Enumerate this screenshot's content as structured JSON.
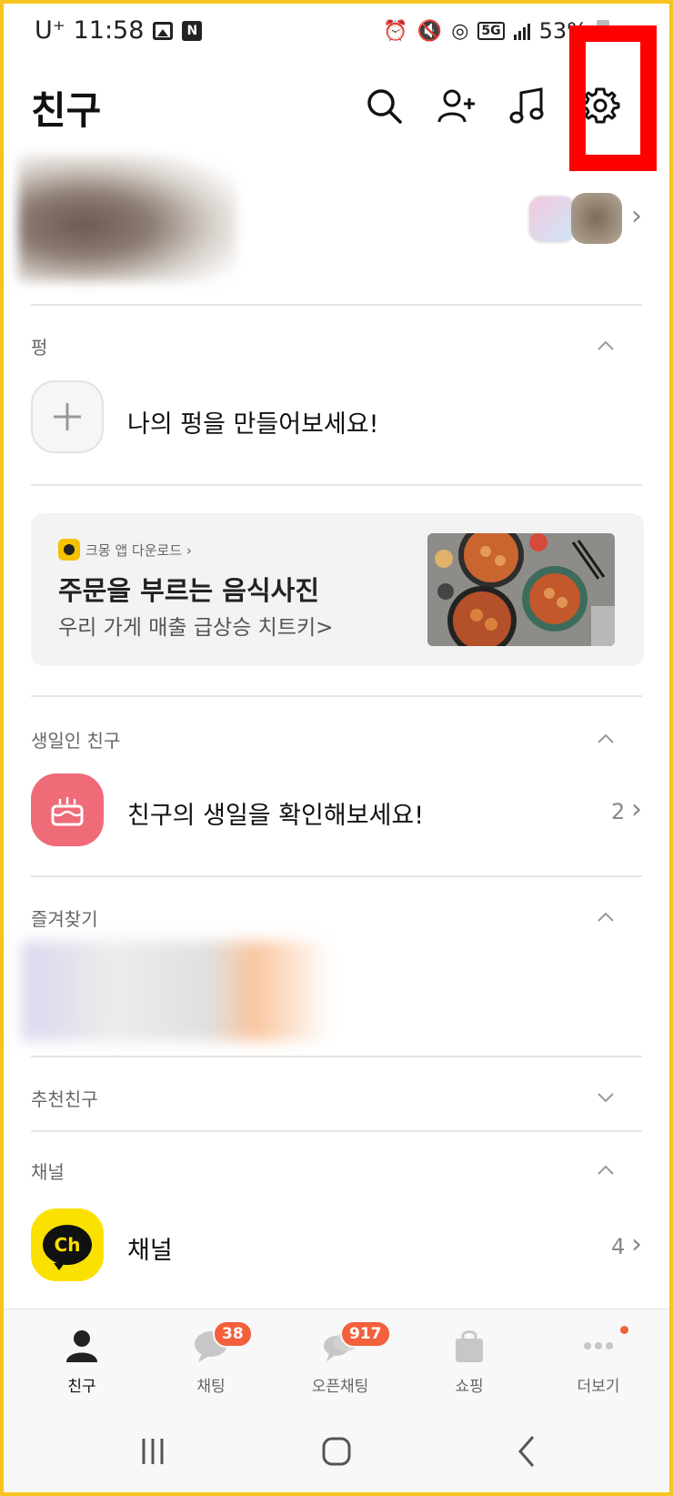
{
  "status_bar": {
    "carrier_time": "U⁺ 11:58",
    "battery": "53%"
  },
  "header": {
    "title": "친구",
    "icons": [
      "search-icon",
      "add-friend-icon",
      "music-icon",
      "settings-icon"
    ],
    "highlight_color": "#ff0000"
  },
  "sections": {
    "pung": {
      "label": "펑",
      "create_text": "나의 펑을 만들어보세요!"
    },
    "ad": {
      "brand": "크몽 앱 다운로드 ›",
      "title": "주문을 부르는 음식사진",
      "subtitle": "우리 가게 매출 급상승 치트키>"
    },
    "birthday": {
      "label": "생일인 친구",
      "text": "친구의 생일을 확인해보세요!",
      "count": "2"
    },
    "favorites": {
      "label": "즐겨찾기"
    },
    "recommended": {
      "label": "추천친구"
    },
    "channel": {
      "label": "채널",
      "text": "채널",
      "icon_text": "Ch",
      "count": "4"
    }
  },
  "tabs": [
    {
      "label": "친구",
      "badge": ""
    },
    {
      "label": "채팅",
      "badge": "38"
    },
    {
      "label": "오픈채팅",
      "badge": "917"
    },
    {
      "label": "쇼핑",
      "badge": ""
    },
    {
      "label": "더보기",
      "badge": ""
    }
  ],
  "colors": {
    "accent_yellow": "#fae100",
    "badge_red": "#f2603c",
    "birthday_pink": "#f06b78"
  }
}
